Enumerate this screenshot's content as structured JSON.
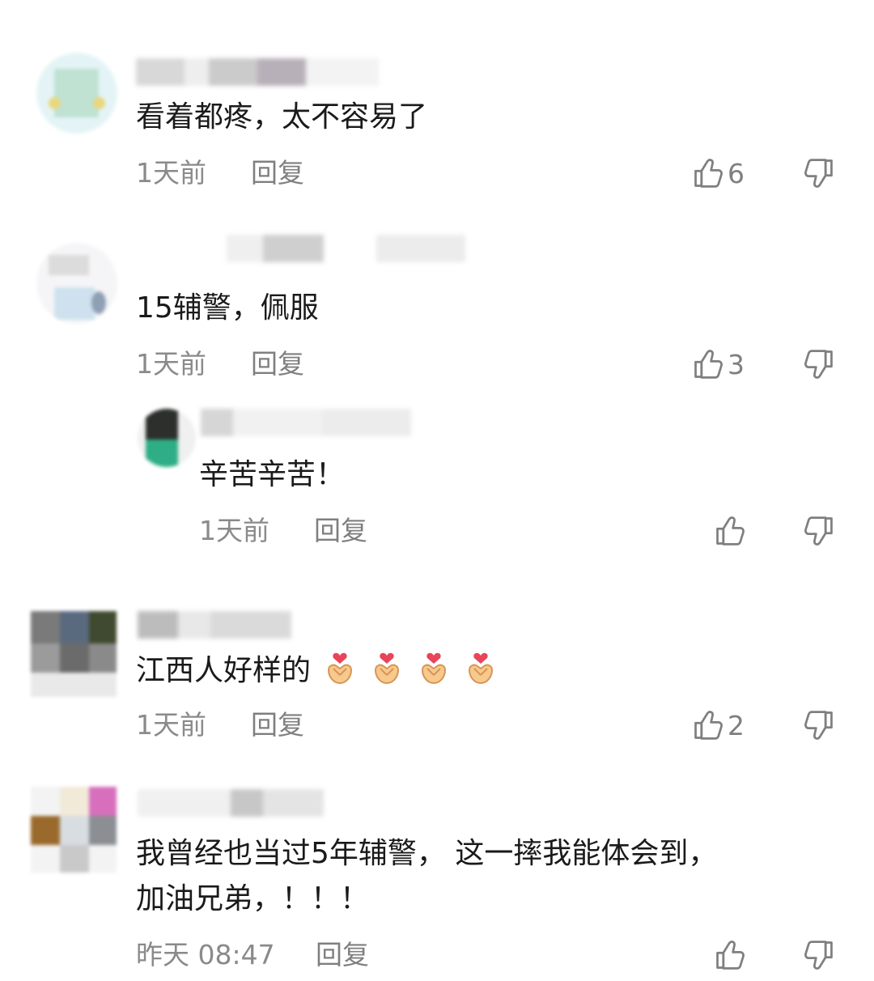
{
  "comments": [
    {
      "text": "看着都疼，太不容易了",
      "time": "1天前",
      "reply_label": "回复",
      "likes": "6"
    },
    {
      "text": "15辅警，佩服",
      "time": "1天前",
      "reply_label": "回复",
      "likes": "3"
    },
    {
      "text": "辛苦辛苦！",
      "time": "1天前",
      "reply_label": "回复",
      "likes": ""
    },
    {
      "text": "江西人好样的",
      "time": "1天前",
      "reply_label": "回复",
      "likes": "2",
      "emoji": [
        "heart-hands-emoji",
        "heart-hands-emoji",
        "heart-hands-emoji",
        "heart-hands-emoji"
      ]
    },
    {
      "text_line1": "我曾经也当过5年辅警， 这一摔我能体会到，",
      "text_line2": "加油兄弟，！！！",
      "time": "昨天 08:47",
      "reply_label": "回复",
      "likes": ""
    }
  ],
  "icons": {
    "like": "thumbs-up-icon",
    "dislike": "thumbs-down-icon"
  },
  "colors": {
    "text": "#1a1a1a",
    "meta": "#8a8a8a",
    "icon": "#7f7f7f"
  }
}
